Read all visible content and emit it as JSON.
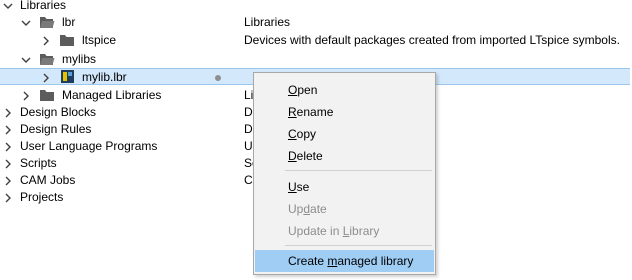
{
  "tree": {
    "libraries": {
      "label": "Libraries"
    },
    "lbr": {
      "label": "lbr",
      "description": "Libraries"
    },
    "ltspice": {
      "label": "ltspice",
      "description": "Devices with default packages created from imported LTspice symbols."
    },
    "mylibs": {
      "label": "mylibs"
    },
    "mylib": {
      "label": "mylib.lbr"
    },
    "managed": {
      "label": "Managed Libraries",
      "description": "Li"
    },
    "design_blocks": {
      "label": "Design Blocks",
      "description": "D"
    },
    "design_rules": {
      "label": "Design Rules",
      "description": "D"
    },
    "ulp": {
      "label": "User Language Programs",
      "description": "U"
    },
    "scripts": {
      "label": "Scripts",
      "description": "Sc"
    },
    "cam_jobs": {
      "label": "CAM Jobs",
      "description": "C"
    },
    "projects": {
      "label": "Projects"
    }
  },
  "menu": {
    "open": {
      "pre": "",
      "u": "O",
      "post": "pen"
    },
    "rename": {
      "pre": "",
      "u": "R",
      "post": "ename"
    },
    "copy": {
      "pre": "",
      "u": "C",
      "post": "opy"
    },
    "delete": {
      "pre": "",
      "u": "D",
      "post": "elete"
    },
    "use": {
      "pre": "",
      "u": "U",
      "post": "se"
    },
    "update": {
      "pre": "Up",
      "u": "d",
      "post": "ate"
    },
    "update_in_library": {
      "pre": "Update in ",
      "u": "L",
      "post": "ibrary"
    },
    "create_managed": {
      "pre": "Create ",
      "u": "m",
      "post": "anaged library"
    }
  },
  "colors": {
    "folder": "#5c5c5c",
    "selection": "#d3e8fb",
    "menu_highlight": "#9fcdf4",
    "disabled_text": "#8d8d8d"
  },
  "icons": {
    "expanded": "chevron-down-icon",
    "collapsed": "chevron-right-icon",
    "folder": "folder-icon",
    "library": "library-file-icon",
    "status": "status-dot-icon"
  }
}
